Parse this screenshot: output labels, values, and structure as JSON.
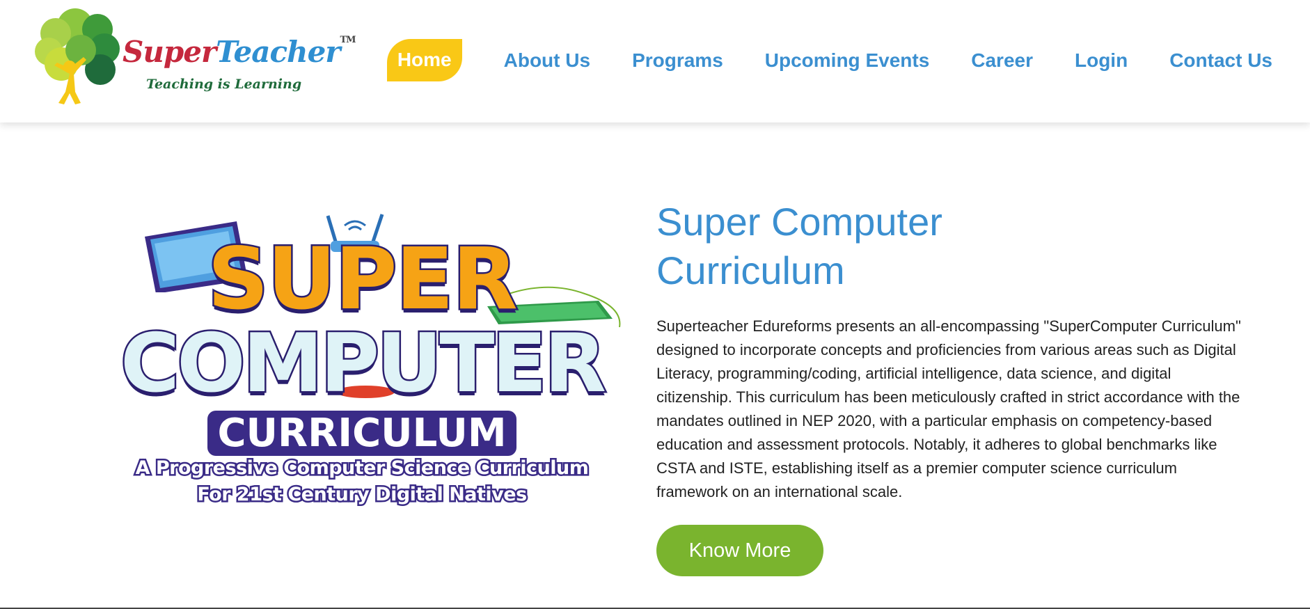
{
  "brand": {
    "name_part1": "Super",
    "name_part2": "Teacher",
    "trademark": "TM",
    "tagline": "Teaching is Learning",
    "colors": {
      "primary_red": "#c5283d",
      "primary_blue": "#2f8fd1",
      "tagline_green": "#1f6b3b"
    }
  },
  "nav": {
    "items": [
      {
        "label": "Home",
        "active": true
      },
      {
        "label": "About Us",
        "active": false
      },
      {
        "label": "Programs",
        "active": false
      },
      {
        "label": "Upcoming Events",
        "active": false
      },
      {
        "label": "Career",
        "active": false
      },
      {
        "label": "Login",
        "active": false
      },
      {
        "label": "Contact Us",
        "active": false
      }
    ],
    "colors": {
      "link": "#3b8fd0",
      "active_bg": "#f9c816",
      "active_text": "#ffffff"
    }
  },
  "hero_art": {
    "line1": "SUPER",
    "line2": "COMPUTER",
    "line3": "CURRICULUM",
    "subtitle_line1": "A Progressive Computer Science Curriculum",
    "subtitle_line2": "For 21st Century Digital Natives",
    "icons": [
      "laptop-icon",
      "wifi-router-icon",
      "keyboard-icon",
      "mouse-icon"
    ]
  },
  "hero": {
    "title_line1": "Super Computer",
    "title_line2": "Curriculum",
    "body": "Superteacher Edureforms presents an all-encompassing \"SuperComputer Curriculum\" designed to incorporate concepts and proficiencies from various areas such as Digital Literacy, programming/coding, artificial intelligence, data science, and digital citizenship. This curriculum has been meticulously crafted in strict accordance with the mandates outlined in NEP 2020, with a particular emphasis on competency-based education and assessment protocols. Notably, it adheres to global benchmarks like CSTA and ISTE, establishing itself as a premier computer science curriculum framework on an international scale.",
    "cta_label": "Know More",
    "colors": {
      "title": "#3b8fd0",
      "cta_bg": "#7ab42e"
    }
  }
}
